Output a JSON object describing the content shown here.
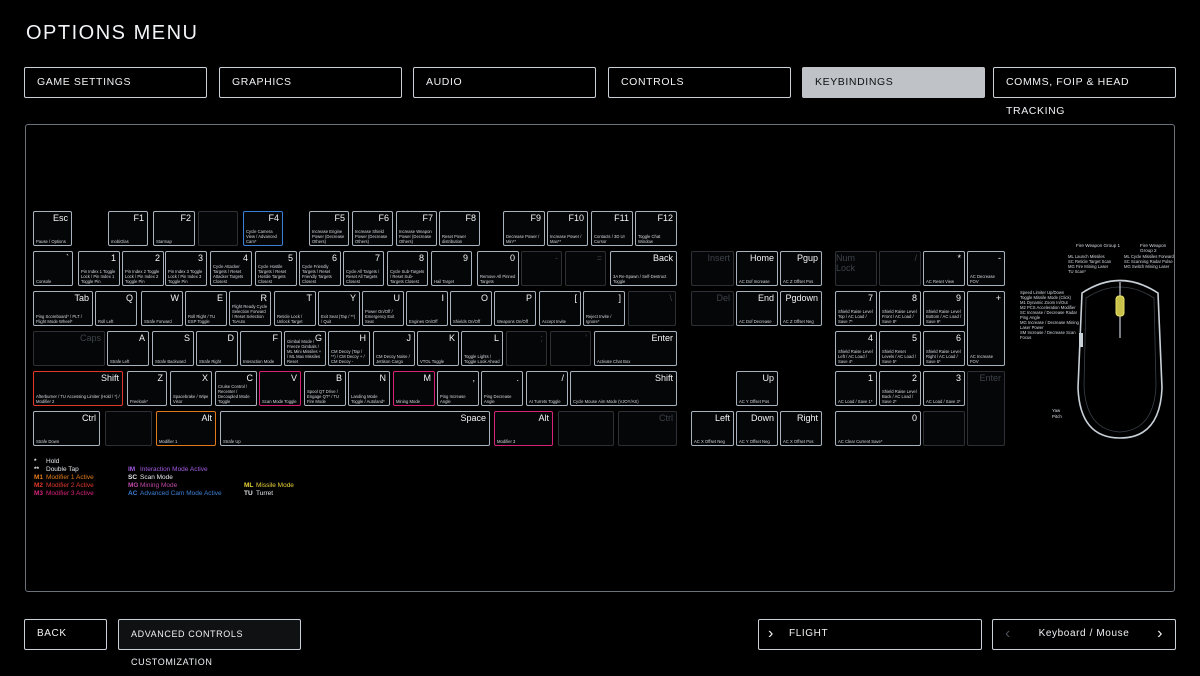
{
  "title": "OPTIONS MENU",
  "tabs": [
    {
      "label": "GAME SETTINGS"
    },
    {
      "label": "GRAPHICS"
    },
    {
      "label": "AUDIO"
    },
    {
      "label": "CONTROLS"
    },
    {
      "label": "KEYBINDINGS"
    },
    {
      "label": "COMMS, FOIP & HEAD TRACKING"
    }
  ],
  "keys": {
    "esc": {
      "label": "Esc",
      "action": "Pause / Options"
    },
    "f1": {
      "label": "F1",
      "action": "mobiGlas"
    },
    "f2": {
      "label": "F2",
      "action": "Starmap"
    },
    "f4": {
      "label": "F4",
      "action": "Cycle Camera View / Advanced Cam*"
    },
    "f5": {
      "label": "F5",
      "action": "Increase Engine Power (Decrease Others)"
    },
    "f6": {
      "label": "F6",
      "action": "Increase Shield Power (Decrease Others)"
    },
    "f7": {
      "label": "F7",
      "action": "Increase Weapon Power (Decrease Others)"
    },
    "f8": {
      "label": "F8",
      "action": "Reset Power distribution"
    },
    "f9": {
      "label": "F9",
      "action": "Decrease Power / Min**"
    },
    "f10": {
      "label": "F10",
      "action": "Increase Power / Max**"
    },
    "f11": {
      "label": "F11",
      "action": "Contacts / 3D UI Cursor"
    },
    "f12": {
      "label": "F12",
      "action": "Toggle Chat Window"
    },
    "tilde": {
      "label": "`",
      "action": "Console"
    },
    "n1": {
      "label": "1",
      "action": "Pin Index 1 Toggle Lock / Pin Index 1 Toggle Pin"
    },
    "n2": {
      "label": "2",
      "action": "Pin Index 2 Toggle Lock / Pin Index 2 Toggle Pin"
    },
    "n3": {
      "label": "3",
      "action": "Pin Index 3 Toggle Lock / Pin Index 3 Toggle Pin"
    },
    "n4": {
      "label": "4",
      "action": "Cycle Attacker Targets / Reset Attacker Targets Closest"
    },
    "n5": {
      "label": "5",
      "action": "Cycle Hostile Targets / Reset Hostile Targets Closest"
    },
    "n6": {
      "label": "6",
      "action": "Cycle Friendly Targets / Reset Friendly Targets Closest"
    },
    "n7": {
      "label": "7",
      "action": "Cycle All Targets / Reset All Targets Closest"
    },
    "n8": {
      "label": "8",
      "action": "Cycle Sub-Targets / Reset Sub-Targets Closest"
    },
    "n9": {
      "label": "9",
      "action": "Hail Target"
    },
    "n0": {
      "label": "0",
      "action": "Remove All Pinned Targets"
    },
    "minus": {
      "label": "-",
      "action": ""
    },
    "equals": {
      "label": "=",
      "action": ""
    },
    "back": {
      "label": "Back",
      "action": "3A Re-Spawn / Self-Destruct Toggle"
    },
    "tab": {
      "label": "Tab",
      "action": "Ping Scoreboard* / PLT / Flight Mode Wheel*"
    },
    "q": {
      "label": "Q",
      "action": "Roll Left"
    },
    "w": {
      "label": "W",
      "action": "Strafe Forward"
    },
    "e": {
      "label": "E",
      "action": "Roll Right / TU ESP Toggle"
    },
    "r": {
      "label": "R",
      "action": "Flight Ready Cycle Selection Forward / Reset Selection ToAuto"
    },
    "t": {
      "label": "T",
      "action": "Reticle Lock / Unlock Target"
    },
    "y": {
      "label": "Y",
      "action": "Exit Seat (Tap / **) / Quit"
    },
    "u": {
      "label": "U",
      "action": "Power On/Off / Emergency Exit Seat"
    },
    "i": {
      "label": "I",
      "action": "Engines On/Off"
    },
    "o": {
      "label": "O",
      "action": "Shields On/Off"
    },
    "p": {
      "label": "P",
      "action": "Weapons On/Off"
    },
    "lbracket": {
      "label": "[",
      "action": "Accept Invite"
    },
    "rbracket": {
      "label": "]",
      "action": "Reject Invite / Ignore*"
    },
    "backslash": {
      "label": "\\",
      "action": ""
    },
    "caps": {
      "label": "Caps",
      "action": ""
    },
    "a": {
      "label": "A",
      "action": "Strafe Left"
    },
    "s": {
      "label": "S",
      "action": "Strafe Backward"
    },
    "d": {
      "label": "D",
      "action": "Strafe Right"
    },
    "f": {
      "label": "F",
      "action": "Interaction Mode"
    },
    "g": {
      "label": "G",
      "action": "Gimbal Mode / Freeze Gimbals / ML Mini Missiles + / ML Max Missiles Reset"
    },
    "h": {
      "label": "H",
      "action": "CM Decoy (Tap / **) / CM Decoy + / CM Decoy -"
    },
    "j": {
      "label": "J",
      "action": "CM Decoy Noise / Jettison Cargo"
    },
    "k": {
      "label": "K",
      "action": "VTOL Toggle"
    },
    "l": {
      "label": "L",
      "action": "Toggle Lights / Toggle Look Ahead"
    },
    "semicolon": {
      "label": ";",
      "action": ""
    },
    "quote": {
      "label": "'",
      "action": ""
    },
    "enter": {
      "label": "Enter",
      "action": "Activate Chat Box"
    },
    "lshift": {
      "label": "Shift",
      "action": "Afterburner / TU Accessing Limiter (Hold / *) / Modifier 2"
    },
    "z": {
      "label": "Z",
      "action": "Freelook*"
    },
    "x": {
      "label": "X",
      "action": "Spacebrake / Wipe Visor"
    },
    "c": {
      "label": "C",
      "action": "Cruise Control / Recenter / Decoupled Mode Toggle"
    },
    "v": {
      "label": "V",
      "action": "Scan Mode Toggle"
    },
    "b": {
      "label": "B",
      "action": "Spool QT Drive / Engage QT* / TU Fire Mode"
    },
    "n": {
      "label": "N",
      "action": "Landing Mode Toggle / Autoland*"
    },
    "m": {
      "label": "M",
      "action": "Mining Mode"
    },
    "comma": {
      "label": ",",
      "action": "Ping Increase Angle"
    },
    "period": {
      "label": ".",
      "action": "Ping Decrease Angle"
    },
    "slash": {
      "label": "/",
      "action": "AI Turrets Toggle"
    },
    "rshift": {
      "label": "Shift",
      "action": "Cycle Mouse Aim Mode (VJOY/AS)"
    },
    "lctrl": {
      "label": "Ctrl",
      "action": "Strafe Down"
    },
    "lalt": {
      "label": "Alt",
      "action": "Modifier 1"
    },
    "space": {
      "label": "Space",
      "action": "Strafe Up"
    },
    "ralt": {
      "label": "Alt",
      "action": "Modifier 3"
    },
    "rctrl": {
      "label": "Ctrl",
      "action": ""
    },
    "insert": {
      "label": "Insert",
      "action": ""
    },
    "home": {
      "label": "Home",
      "action": "AC Dof Increase"
    },
    "pgup": {
      "label": "Pgup",
      "action": "AC Z Offset Pos"
    },
    "del": {
      "label": "Del",
      "action": ""
    },
    "end": {
      "label": "End",
      "action": "AC Dof Decrease"
    },
    "pgdown": {
      "label": "Pgdown",
      "action": "AC Z Offset Neg"
    },
    "up": {
      "label": "Up",
      "action": "AC Y Offset Pos"
    },
    "left": {
      "label": "Left",
      "action": "AC X Offset Neg"
    },
    "down": {
      "label": "Down",
      "action": "AC Y Offset Neg"
    },
    "right": {
      "label": "Right",
      "action": "AC X Offset Pos"
    },
    "numlock": {
      "label": "Num Lock",
      "action": ""
    },
    "npslash": {
      "label": "/",
      "action": ""
    },
    "npstar": {
      "label": "*",
      "action": "AC Reset View"
    },
    "npminus": {
      "label": "-",
      "action": "AC Decrease FOV"
    },
    "np7": {
      "label": "7",
      "action": "Shield Raise Level Top / AC Load / Save 7*"
    },
    "np8": {
      "label": "8",
      "action": "Shield Raise Level Front / AC Load / Save 8*"
    },
    "np9": {
      "label": "9",
      "action": "Shield Raise Level Bottom / AC Load / Save 9*"
    },
    "npplus": {
      "label": "+",
      "action": "AC Increase FOV"
    },
    "np4": {
      "label": "4",
      "action": "Shield Raise Level Left / AC Load / Save 4*"
    },
    "np5": {
      "label": "5",
      "action": "Shield Reset Levels / AC Load / Save 5*"
    },
    "np6": {
      "label": "6",
      "action": "Shield Raise Level Right / AC Load / Save 6*"
    },
    "np1": {
      "label": "1",
      "action": "AC Load / Save 1*"
    },
    "np2": {
      "label": "2",
      "action": "Shield Raise Level Back / AC Load / Save 2*"
    },
    "np3": {
      "label": "3",
      "action": "AC Load / Save 3*"
    },
    "npenter": {
      "label": "Enter",
      "action": ""
    },
    "np0": {
      "label": "0",
      "action": "AC Clear Current Save*"
    },
    "npdot": {
      "label": "",
      "action": ""
    }
  },
  "legend": [
    {
      "code": "*",
      "text": "Hold",
      "color": "#e6e9ed"
    },
    {
      "code": "**",
      "text": "Double Tap",
      "color": "#e6e9ed"
    },
    {
      "code": "M1",
      "text": "Modifier 1 Active",
      "color": "#e07a1a"
    },
    {
      "code": "M2",
      "text": "Modifier 2 Active",
      "color": "#e0392b"
    },
    {
      "code": "M3",
      "text": "Modifier 3 Active",
      "color": "#d6237a"
    }
  ],
  "legend2": [
    {
      "code": "IM",
      "text": "Interaction Mode Active",
      "color": "#a35be0"
    },
    {
      "code": "SC",
      "text": "Scan Mode",
      "color": "#e6e9ed"
    },
    {
      "code": "MG",
      "text": "Mining Mode",
      "color": "#c04aa8"
    },
    {
      "code": "AC",
      "text": "Advanced Cam Mode Active",
      "color": "#3b7fd6"
    }
  ],
  "legend3": [
    {
      "code": "ML",
      "text": "Missile Mode",
      "color": "#e8d43a"
    },
    {
      "code": "TU",
      "text": "Turret",
      "color": "#e6e9ed"
    }
  ],
  "mouse": {
    "group1_title": "Fire Weapon Group 1",
    "group2_title": "Fire Weapon Group 2",
    "left_lines": [
      "ML Launch Missiles",
      "SC Reticle Target Scan",
      "MG Fire Mining Laser",
      "TU Scan*"
    ],
    "right_lines": [
      "ML Cycle Missiles Forward",
      "SC Scanning Radar Pulse",
      "MG Switch Mining Laser"
    ],
    "wheel_lines": [
      "Speed Limiter Up/Down",
      "Toggle Missile Mode (Click)",
      "M1 Dynamic Zoom In/Out",
      "M2 PCS Acceleration Modifier",
      "SC Increase / Decrease Radar Ping Angle",
      "MG Increase / Decrease Mining Laser Power",
      "SM Increase / Decrease Scan Focus"
    ],
    "yaw_label": "Yaw",
    "pitch_label": "Pitch"
  },
  "bottom": {
    "back_label": "BACK",
    "advanced_label": "ADVANCED CONTROLS CUSTOMIZATION",
    "mode_label": "FLIGHT",
    "device_label": "Keyboard / Mouse"
  }
}
